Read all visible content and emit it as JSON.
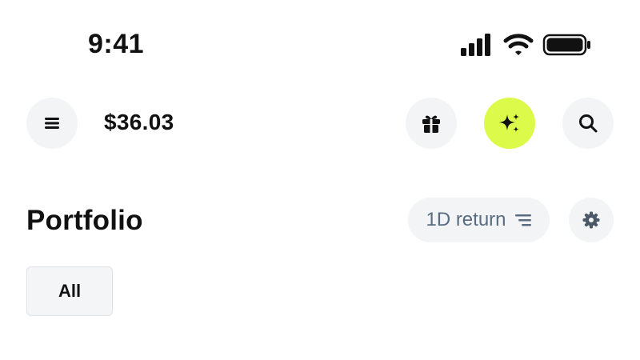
{
  "status_bar": {
    "time": "9:41",
    "icons": [
      "cellular-signal-icon",
      "wifi-icon",
      "battery-icon"
    ]
  },
  "header": {
    "balance": "$36.03",
    "buttons": [
      "menu-icon",
      "gift-icon",
      "sparkles-icon",
      "search-icon"
    ],
    "ai_button_color": "#dcfa4a"
  },
  "portfolio": {
    "title": "Portfolio",
    "return_filter_label": "1D return",
    "return_filter_icon": "sort-icon",
    "settings_icon": "gear-icon",
    "filter_chip": "All"
  },
  "colors": {
    "button_bg": "#f2f4f6",
    "muted_text": "#5a6c80",
    "text": "#111111"
  }
}
